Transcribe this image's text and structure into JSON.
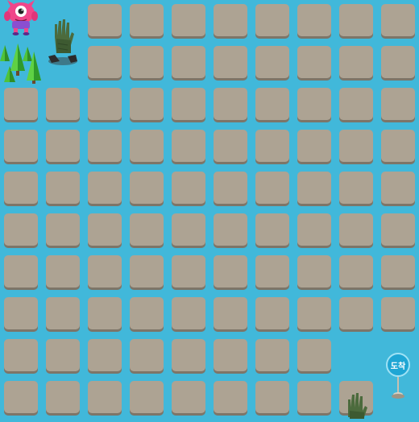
{
  "board": {
    "rows": 10,
    "cols": 10,
    "empty_cells": [
      [
        0,
        0
      ],
      [
        0,
        1
      ],
      [
        1,
        0
      ],
      [
        1,
        1
      ],
      [
        8,
        8
      ],
      [
        8,
        9
      ],
      [
        9,
        9
      ]
    ]
  },
  "sprites": {
    "player": {
      "icon": "pink-cyclops-monster-icon",
      "row": 0,
      "col": 0
    },
    "trees": {
      "icon": "pine-trees-icon",
      "row": 1,
      "col": 0
    },
    "zombie_hand_1": {
      "icon": "zombie-hand-icon",
      "row": 1,
      "col": 1
    },
    "zombie_hand_2": {
      "icon": "zombie-hand-icon",
      "row": 9,
      "col": 8
    },
    "finish": {
      "icon": "finish-marker-icon",
      "row": 9,
      "col": 9,
      "label": "도착"
    }
  },
  "colors": {
    "water": "#41b8da",
    "tile": "#ada393",
    "tile_shadow": "#7d7568",
    "player": "#f0468a",
    "finish": "#1fa6d4"
  }
}
